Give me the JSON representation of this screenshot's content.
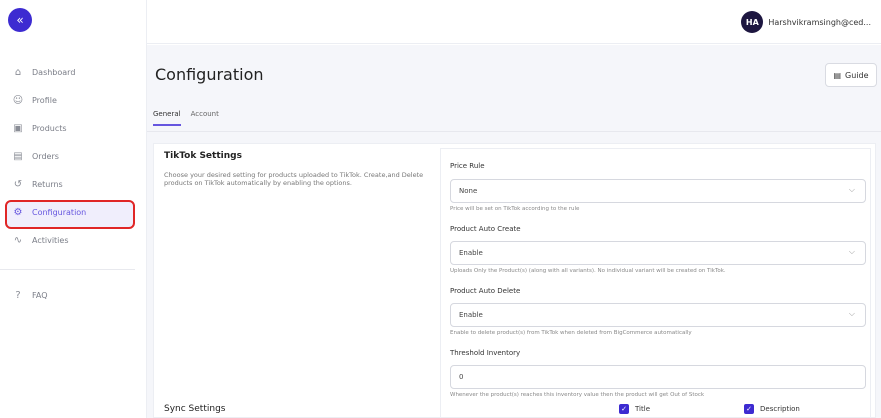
{
  "sidebar": {
    "collapse_icon": "«",
    "items": [
      {
        "label": "Dashboard",
        "icon": "⌂"
      },
      {
        "label": "Profile",
        "icon": "☺"
      },
      {
        "label": "Products",
        "icon": "▣"
      },
      {
        "label": "Orders",
        "icon": "▤"
      },
      {
        "label": "Returns",
        "icon": "↺"
      },
      {
        "label": "Configuration",
        "icon": "⚙"
      },
      {
        "label": "Activities",
        "icon": "∿"
      }
    ],
    "faq": {
      "label": "FAQ",
      "icon": "?"
    }
  },
  "header": {
    "avatar_initials": "HA",
    "email": "Harshvikramsingh@ced..."
  },
  "page": {
    "title": "Configuration",
    "guide_label": "Guide",
    "tabs": [
      "General",
      "Account"
    ]
  },
  "section": {
    "title": "TikTok Settings",
    "description": "Choose your desired setting for products uploaded to TikTok. Create,and Delete products on TikTok automatically by enabling the options."
  },
  "fields": [
    {
      "label": "Price Rule",
      "value": "None",
      "hint": "Price will be set on TikTok according to the rule"
    },
    {
      "label": "Product Auto Create",
      "value": "Enable",
      "hint": "Uploads Only the Product(s) (along with all variants). No individual variant will be created on TikTok."
    },
    {
      "label": "Product Auto Delete",
      "value": "Enable",
      "hint": "Enable to delete product(s) from TikTok when deleted from BigCommerce automatically"
    },
    {
      "label": "Threshold Inventory",
      "value": "0",
      "hint": "Whenever the product(s) reaches this inventory value then the product will get Out of Stock"
    }
  ],
  "sync": {
    "title": "Sync Settings",
    "options": [
      {
        "label": "Title",
        "checked": true
      },
      {
        "label": "Description",
        "checked": true
      }
    ]
  },
  "colors": {
    "accent": "#3d2bd1",
    "active_outline": "#e02626",
    "background": "#f5f6fa"
  }
}
